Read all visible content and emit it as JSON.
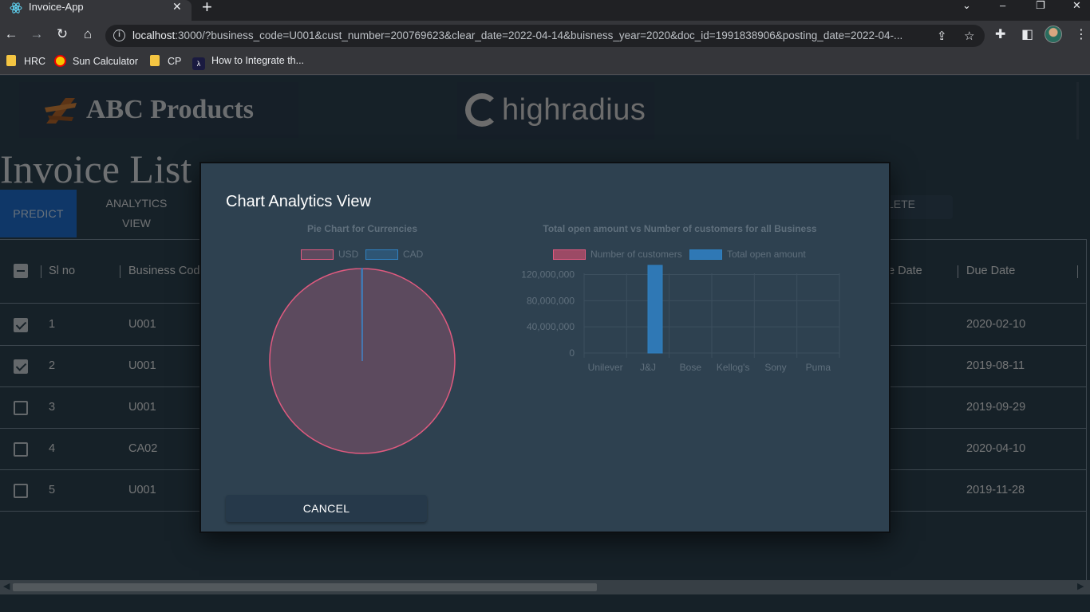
{
  "browser": {
    "tab_title": "Invoice-App",
    "tab_close": "✕",
    "new_tab": "+",
    "window_controls": [
      "⌄",
      "–",
      "❐",
      "✕"
    ],
    "url_host": "localhost",
    "url_rest": ":3000/?business_code=U001&cust_number=200769623&clear_date=2022-04-14&buisness_year=2020&doc_id=1991838906&posting_date=2022-04-...",
    "nav_icons": [
      "←",
      "→",
      "↻",
      "⌂"
    ],
    "bookmarks": [
      "HRC",
      "Sun Calculator",
      "CP",
      "How to Integrate th..."
    ]
  },
  "app": {
    "brand_left": "ABC Products",
    "brand_center": "highradius",
    "page_title": "Invoice List",
    "predict_label": "PREDICT",
    "analytics_label_1": "ANALYTICS",
    "analytics_label_2": "VIEW",
    "delete_fragment": "LETE",
    "columns": {
      "sl_no": "Sl no",
      "business_code": "Business Cod",
      "clear_date_fragment": "e Date",
      "due_date": "Due Date"
    },
    "rows": [
      {
        "sl": "1",
        "code": "U001",
        "due": "2020-02-10",
        "checked": true
      },
      {
        "sl": "2",
        "code": "U001",
        "due": "2019-08-11",
        "checked": true
      },
      {
        "sl": "3",
        "code": "U001",
        "due": "2019-09-29",
        "checked": false
      },
      {
        "sl": "4",
        "code": "CA02",
        "due": "2020-04-10",
        "checked": false
      },
      {
        "sl": "5",
        "code": "U001",
        "due": "2019-11-28",
        "checked": false
      }
    ]
  },
  "dialog": {
    "title": "Chart Analytics View",
    "cancel_label": "CANCEL"
  },
  "colors": {
    "pink": "#e05a7f",
    "pink_fill": "#5c4a5e",
    "blue": "#2f80c0",
    "axis_text": "#5f6f7c"
  },
  "chart_data": [
    {
      "type": "pie",
      "title": "Pie Chart for Currencies",
      "legend_position": "top",
      "series": [
        {
          "name": "USD",
          "value": 99.9,
          "color": "#e05a7f"
        },
        {
          "name": "CAD",
          "value": 0.1,
          "color": "#2f80c0"
        }
      ]
    },
    {
      "type": "bar",
      "title": "Total open amount vs Number of customers for all Business",
      "legend_position": "top",
      "categories": [
        "Unilever",
        "J&J",
        "Bose",
        "Kellog's",
        "Sony",
        "Puma"
      ],
      "series": [
        {
          "name": "Number of customers",
          "color": "#e05a7f",
          "values": [
            0,
            0,
            0,
            0,
            0,
            0
          ]
        },
        {
          "name": "Total open amount",
          "color": "#2f80c0",
          "values": [
            0,
            134000000,
            0,
            0,
            0,
            0
          ]
        }
      ],
      "ylim": [
        0,
        134000000
      ],
      "yticks": [
        "120,000,000",
        "80,000,000",
        "40,000,000",
        "0"
      ],
      "grid": true
    }
  ]
}
